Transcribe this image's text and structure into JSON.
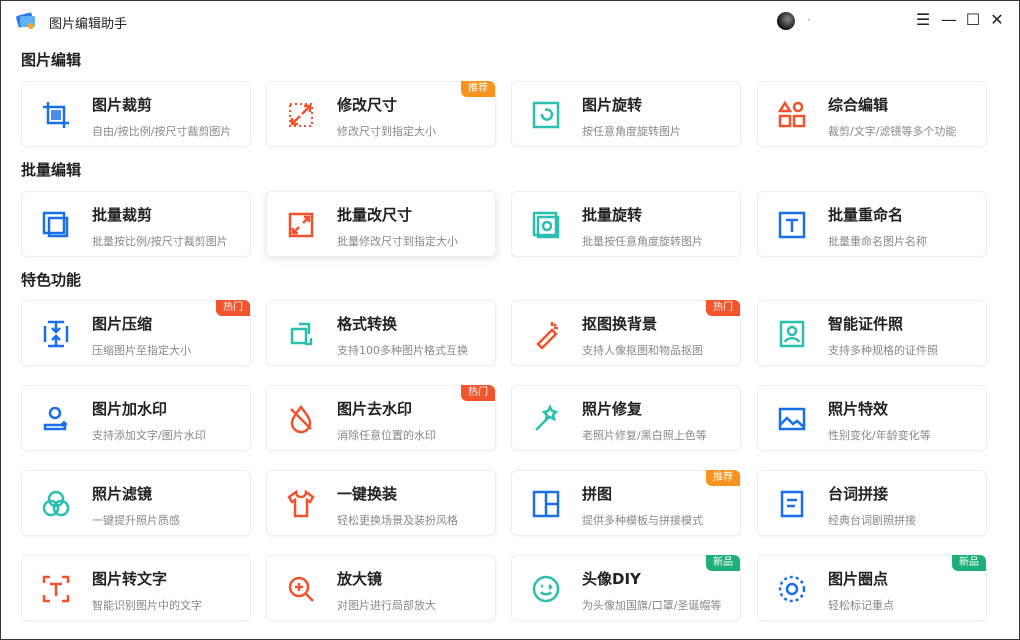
{
  "app": {
    "title": "图片编辑助手",
    "user": "·"
  },
  "colors": {
    "blue": "#1a6fe8",
    "red": "#f0522d",
    "teal": "#2bbfb0",
    "recommend": "#f7931e",
    "hot": "#f2542d",
    "new": "#1fb07a"
  },
  "sections": [
    {
      "title": "图片编辑",
      "cards": [
        {
          "title": "图片裁剪",
          "desc": "自由/按比例/按尺寸裁剪图片",
          "icon": "crop-icon",
          "color": "blue"
        },
        {
          "title": "修改尺寸",
          "desc": "修改尺寸到指定大小",
          "icon": "resize-icon",
          "color": "red",
          "badge": "推荐",
          "badgeType": "recommend"
        },
        {
          "title": "图片旋转",
          "desc": "按任意角度旋转图片",
          "icon": "rotate-icon",
          "color": "teal"
        },
        {
          "title": "综合编辑",
          "desc": "裁剪/文字/滤镜等多个功能",
          "icon": "shapes-icon",
          "color": "red"
        }
      ]
    },
    {
      "title": "批量编辑",
      "cards": [
        {
          "title": "批量裁剪",
          "desc": "批量按比例/按尺寸裁剪图片",
          "icon": "batch-crop-icon",
          "color": "blue"
        },
        {
          "title": "批量改尺寸",
          "desc": "批量修改尺寸到指定大小",
          "icon": "batch-resize-icon",
          "color": "red"
        },
        {
          "title": "批量旋转",
          "desc": "批量按任意角度旋转图片",
          "icon": "batch-rotate-icon",
          "color": "teal"
        },
        {
          "title": "批量重命名",
          "desc": "批量重命名图片名称",
          "icon": "rename-icon",
          "color": "blue"
        }
      ]
    },
    {
      "title": "特色功能",
      "cards": [
        {
          "title": "图片压缩",
          "desc": "压缩图片至指定大小",
          "icon": "compress-icon",
          "color": "blue",
          "badge": "热门",
          "badgeType": "hot"
        },
        {
          "title": "格式转换",
          "desc": "支持100多种图片格式互换",
          "icon": "convert-icon",
          "color": "teal"
        },
        {
          "title": "抠图换背景",
          "desc": "支持人像抠图和物品抠图",
          "icon": "cutout-icon",
          "color": "red",
          "badge": "热门",
          "badgeType": "hot"
        },
        {
          "title": "智能证件照",
          "desc": "支持多种规格的证件照",
          "icon": "id-photo-icon",
          "color": "teal"
        },
        {
          "title": "图片加水印",
          "desc": "支持添加文字/图片水印",
          "icon": "watermark-icon",
          "color": "blue"
        },
        {
          "title": "图片去水印",
          "desc": "消除任意位置的水印",
          "icon": "remove-watermark-icon",
          "color": "red",
          "badge": "热门",
          "badgeType": "hot"
        },
        {
          "title": "照片修复",
          "desc": "老照片修复/黑白照上色等",
          "icon": "magic-wand-icon",
          "color": "teal"
        },
        {
          "title": "照片特效",
          "desc": "性别变化/年龄变化等",
          "icon": "effect-icon",
          "color": "blue"
        },
        {
          "title": "照片滤镜",
          "desc": "一键提升照片质感",
          "icon": "filter-icon",
          "color": "teal"
        },
        {
          "title": "一键换装",
          "desc": "轻松更换场景及装扮风格",
          "icon": "shirt-icon",
          "color": "red"
        },
        {
          "title": "拼图",
          "desc": "提供多种模板与拼接模式",
          "icon": "collage-icon",
          "color": "blue",
          "badge": "推荐",
          "badgeType": "recommend"
        },
        {
          "title": "台词拼接",
          "desc": "经典台词剧照拼接",
          "icon": "subtitle-icon",
          "color": "blue"
        },
        {
          "title": "图片转文字",
          "desc": "智能识别图片中的文字",
          "icon": "ocr-icon",
          "color": "red"
        },
        {
          "title": "放大镜",
          "desc": "对图片进行局部放大",
          "icon": "magnifier-icon",
          "color": "red"
        },
        {
          "title": "头像DIY",
          "desc": "为头像加国旗/口罩/圣诞帽等",
          "icon": "face-icon",
          "color": "teal",
          "badge": "新品",
          "badgeType": "new"
        },
        {
          "title": "图片圈点",
          "desc": "轻松标记重点",
          "icon": "circle-mark-icon",
          "color": "blue",
          "badge": "新品",
          "badgeType": "new"
        }
      ]
    }
  ]
}
